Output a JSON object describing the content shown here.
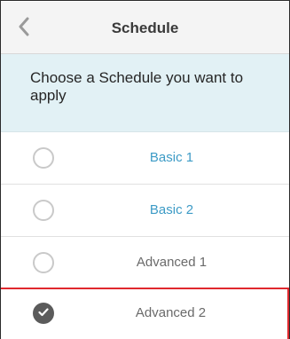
{
  "header": {
    "title": "Schedule",
    "back_icon": "chevron-left-icon"
  },
  "prompt": {
    "text": "Choose a Schedule you want to apply"
  },
  "colors": {
    "accent": "#3d9bc6",
    "selection_border": "#e0282e",
    "prompt_bg": "#e2f1f5"
  },
  "schedules": [
    {
      "label": "Basic 1",
      "selected": false
    },
    {
      "label": "Basic 2",
      "selected": false
    },
    {
      "label": "Advanced 1",
      "selected": false
    },
    {
      "label": "Advanced 2",
      "selected": true
    }
  ]
}
